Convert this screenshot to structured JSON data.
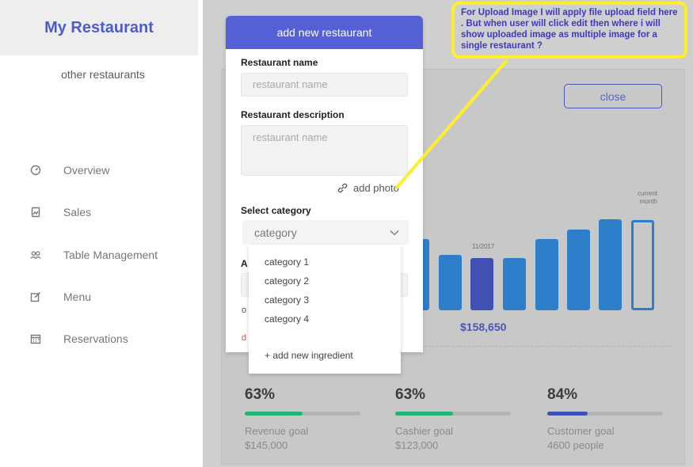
{
  "sidebar": {
    "brand": "My Restaurant",
    "other_restaurants": "other restaurants",
    "items": [
      {
        "label": "Overview",
        "icon": "gauge-icon"
      },
      {
        "label": "Sales",
        "icon": "chart-file-icon"
      },
      {
        "label": "Table Management",
        "icon": "people-icon"
      },
      {
        "label": "Menu",
        "icon": "edit-icon"
      },
      {
        "label": "Reservations",
        "icon": "calendar-icon"
      }
    ]
  },
  "dashboard": {
    "close_label": "close",
    "current_month_label": "current month",
    "highlight_month": "11/2017",
    "amount": "$158,650",
    "bar_values": [
      0.62,
      0.42,
      0.5,
      0.45,
      0.6,
      0.66,
      0.75,
      0.73
    ],
    "goals": [
      {
        "pct": "63%",
        "label": "Revenue goal",
        "value": "$145,000",
        "fill": 0.5,
        "color": "#22b573"
      },
      {
        "pct": "63%",
        "label": "Cashier goal",
        "value": "$123,000",
        "fill": 0.5,
        "color": "#22b573"
      },
      {
        "pct": "84%",
        "label": "Customer goal",
        "value": "4600 people",
        "fill": 0.35,
        "color": "#4150b3"
      }
    ]
  },
  "modal": {
    "title": "add new restaurant",
    "name_label": "Restaurant name",
    "name_placeholder": "restaurant name",
    "desc_label": "Restaurant description",
    "desc_placeholder": "restaurant name",
    "add_photo": "add photo",
    "category_label": "Select category",
    "category_value": "category",
    "partial_label": "A",
    "partial_text": "o",
    "partial_delete": "d"
  },
  "dropdown": {
    "options": [
      "category 1",
      "category 2",
      "category 3",
      "category 4"
    ],
    "add_new": "+ add new ingredient"
  },
  "annotation": {
    "text": "For Upload Image I will apply file upload field here . But when user will click edit then where i will show uploaded image as multiple image for a single restaurant ?"
  },
  "colors": {
    "accent": "#5660d6",
    "bar": "#2e7fc9",
    "highlight_bar": "#4150b3",
    "annotation_border": "#ffef2a"
  }
}
